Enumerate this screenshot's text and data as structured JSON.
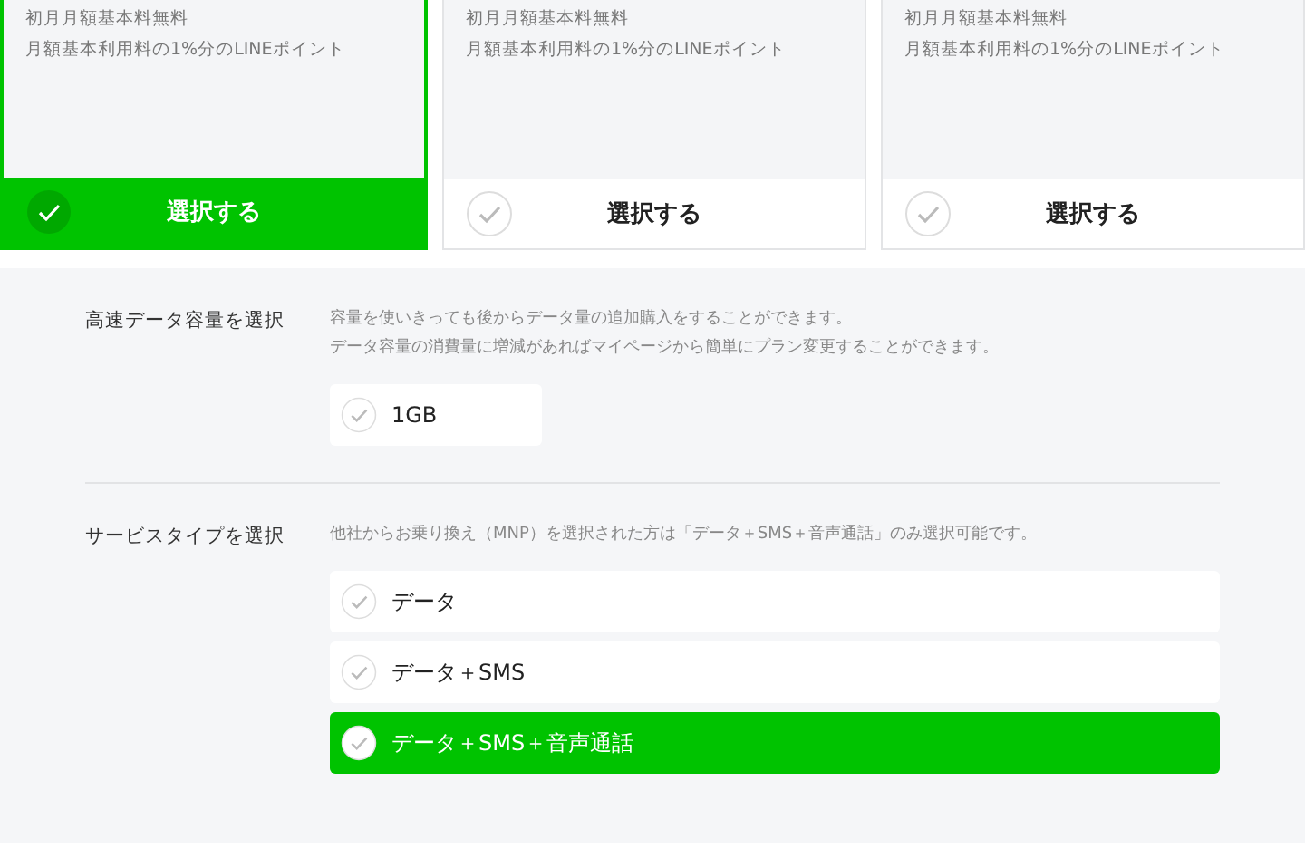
{
  "plans": [
    {
      "lines": [
        "初月月額基本料無料",
        "月額基本利用料の1%分のLINEポイント"
      ],
      "button": "選択する",
      "selected": true
    },
    {
      "lines": [
        "初月月額基本料無料",
        "月額基本利用料の1%分のLINEポイント"
      ],
      "button": "選択する",
      "selected": false
    },
    {
      "lines": [
        "初月月額基本料無料",
        "月額基本利用料の1%分のLINEポイント"
      ],
      "button": "選択する",
      "selected": false
    }
  ],
  "sections": [
    {
      "label": "高速データ容量を選択",
      "notes": [
        "容量を使いきっても後からデータ量の追加購入をすることができます。",
        "データ容量の消費量に増減があればマイページから簡単にプラン変更することができます。"
      ],
      "wide": false,
      "options": [
        {
          "label": "1GB",
          "selected": false
        }
      ]
    },
    {
      "label": "サービスタイプを選択",
      "notes": [
        "他社からお乗り換え（MNP）を選択された方は「データ＋SMS＋音声通話」のみ選択可能です。"
      ],
      "wide": true,
      "options": [
        {
          "label": "データ",
          "selected": false
        },
        {
          "label": "データ＋SMS",
          "selected": false
        },
        {
          "label": "データ＋SMS＋音声通話",
          "selected": true
        }
      ]
    }
  ]
}
